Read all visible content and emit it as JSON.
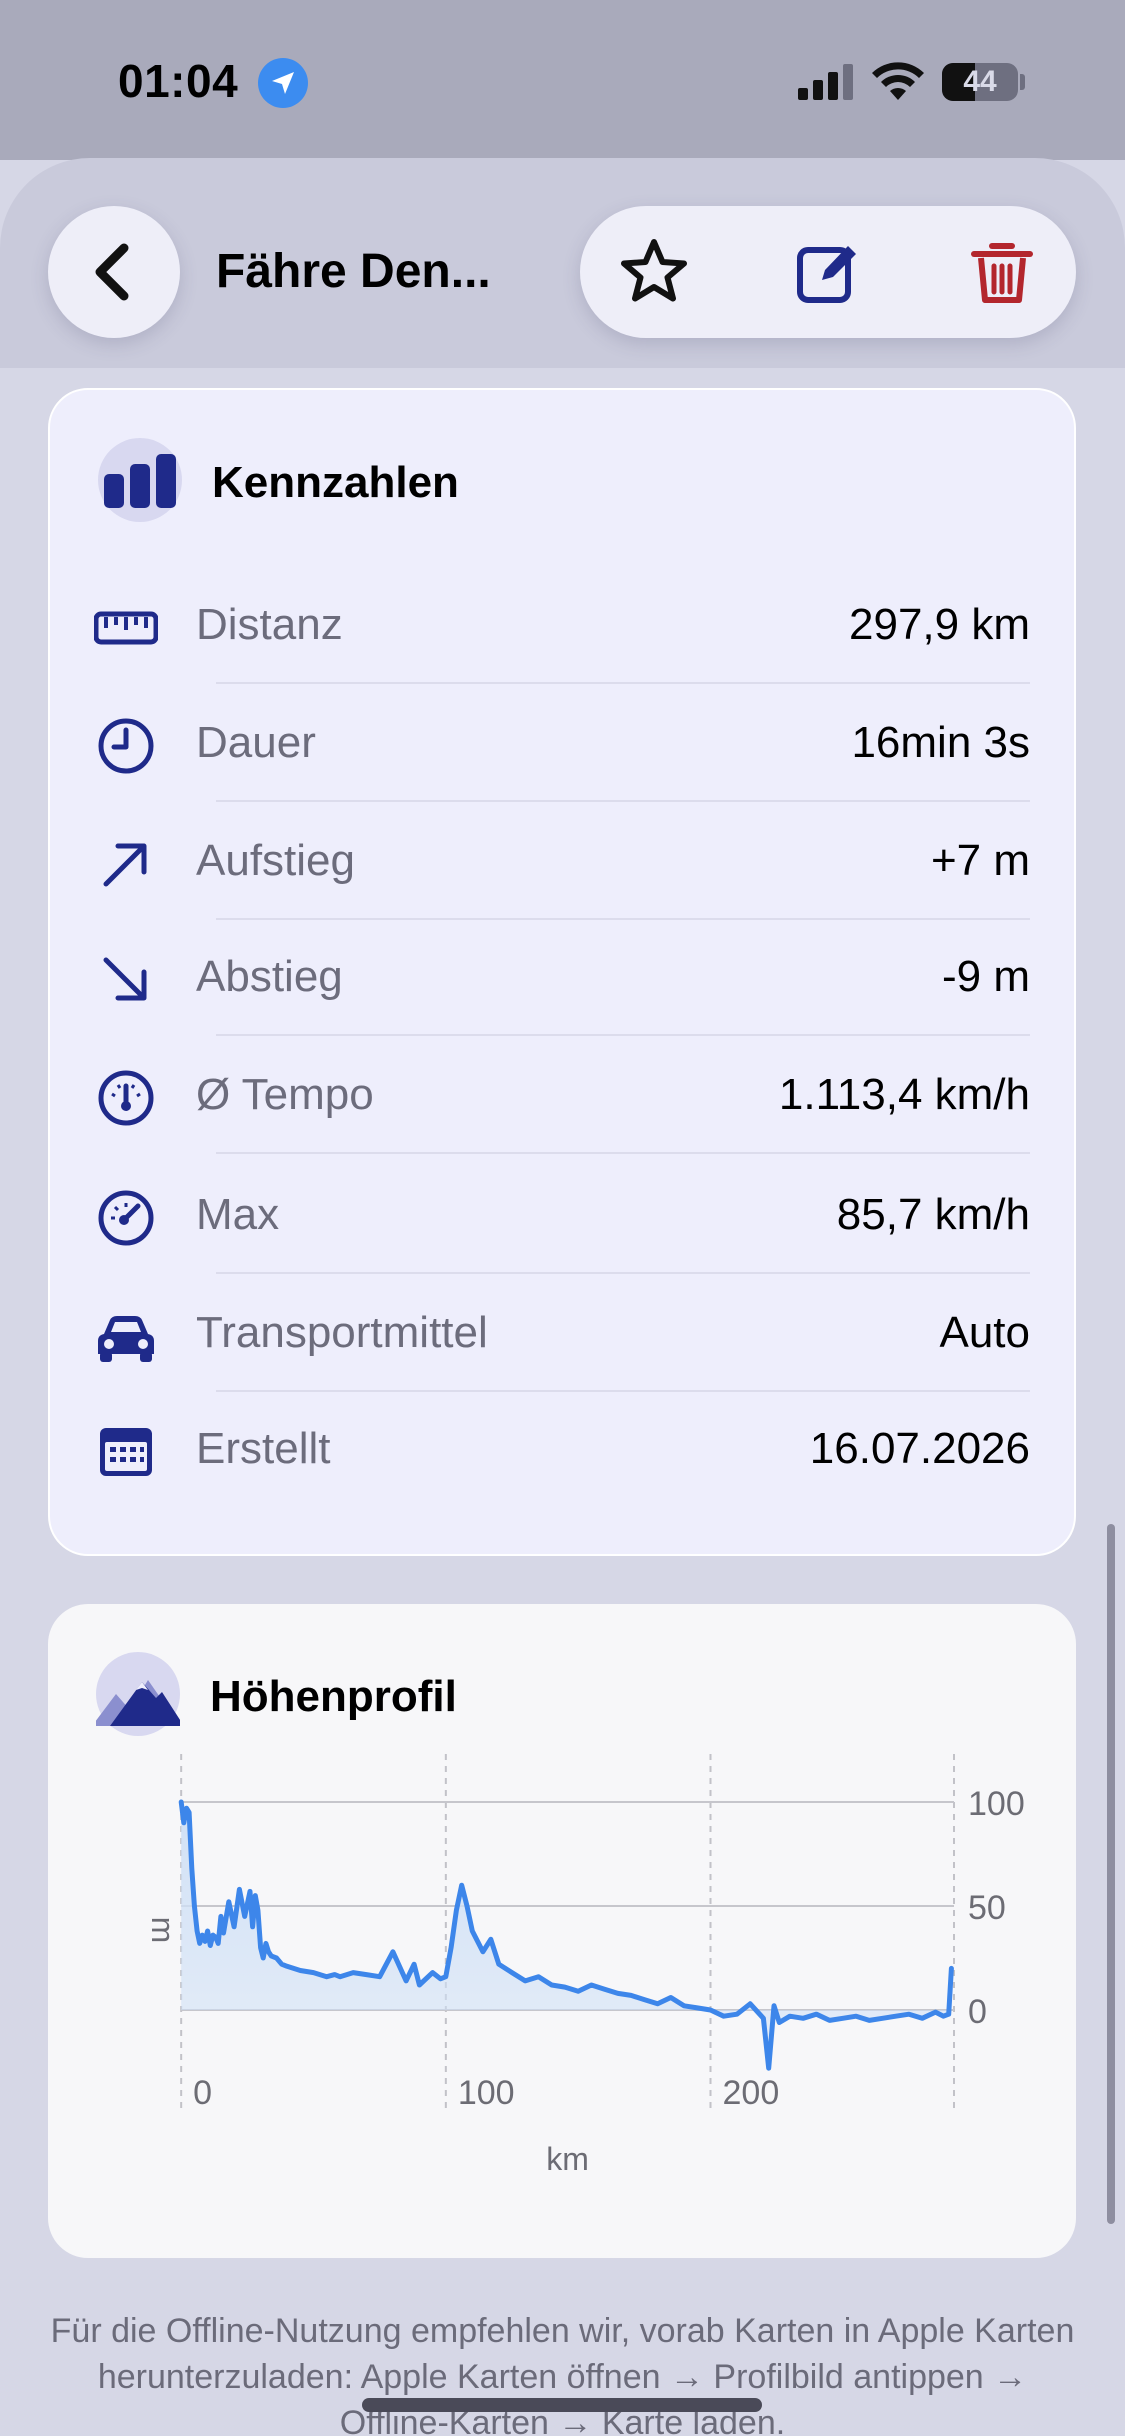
{
  "status_bar": {
    "time": "01:04",
    "battery": "44",
    "battery_level": 0.44
  },
  "nav": {
    "title": "Fähre Den..."
  },
  "colors": {
    "accent": "#1f2a8a",
    "delete": "#b3262d",
    "chart_line": "#3d86ea",
    "chart_fill": "#cfe0f6"
  },
  "stats_card": {
    "title": "Kennzahlen",
    "rows": [
      {
        "icon": "ruler-icon",
        "label": "Distanz",
        "value": "297,9 km"
      },
      {
        "icon": "clock-icon",
        "label": "Dauer",
        "value": "16min 3s"
      },
      {
        "icon": "arrow-up-right-icon",
        "label": "Aufstieg",
        "value": "+7 m"
      },
      {
        "icon": "arrow-down-right-icon",
        "label": "Abstieg",
        "value": "-9 m"
      },
      {
        "icon": "gauge-icon",
        "label": "Ø Tempo",
        "value": "1.113,4 km/h"
      },
      {
        "icon": "speedometer-icon",
        "label": "Max",
        "value": "85,7 km/h"
      },
      {
        "icon": "car-icon",
        "label": "Transportmittel",
        "value": "Auto"
      },
      {
        "icon": "calendar-icon",
        "label": "Erstellt",
        "value": "16.07.2026"
      }
    ]
  },
  "elevation_card": {
    "title": "Höhenprofil"
  },
  "chart_data": {
    "type": "area",
    "xlabel": "km",
    "ylabel": "m",
    "xlim": [
      -8,
      292
    ],
    "ylim": [
      -65,
      100
    ],
    "x_ticks": [
      0,
      100,
      200
    ],
    "y_ticks": [
      0,
      50,
      100
    ],
    "grid": true,
    "series": [
      {
        "x": [
          0,
          1,
          2,
          3,
          4,
          5,
          6,
          7,
          8,
          9,
          10,
          11,
          12,
          13,
          14,
          15,
          16,
          18,
          20,
          22,
          24,
          26,
          27,
          28,
          29,
          30,
          31,
          32,
          33,
          34,
          36,
          38,
          40,
          45,
          50,
          55,
          58,
          60,
          65,
          70,
          75,
          80,
          85,
          88,
          90,
          95,
          98,
          100,
          102,
          104,
          106,
          108,
          110,
          112,
          114,
          117,
          120,
          125,
          130,
          135,
          140,
          145,
          150,
          155,
          160,
          165,
          170,
          175,
          180,
          185,
          190,
          195,
          200,
          205,
          210,
          215,
          220,
          222,
          224,
          226,
          230,
          235,
          240,
          245,
          250,
          255,
          260,
          265,
          270,
          275,
          280,
          285,
          288,
          290,
          291
        ],
        "values": [
          100,
          90,
          97,
          95,
          68,
          50,
          38,
          32,
          36,
          33,
          38,
          31,
          36,
          35,
          32,
          45,
          37,
          52,
          40,
          58,
          45,
          57,
          40,
          55,
          48,
          30,
          25,
          32,
          28,
          26,
          25,
          22,
          21,
          19,
          18,
          16,
          17,
          16,
          18,
          17,
          16,
          28,
          14,
          22,
          12,
          18,
          15,
          16,
          30,
          48,
          60,
          50,
          38,
          33,
          28,
          34,
          22,
          18,
          14,
          16,
          12,
          11,
          9,
          12,
          10,
          8,
          7,
          5,
          3,
          6,
          2,
          1,
          0,
          -3,
          -2,
          3,
          -4,
          -28,
          2,
          -6,
          -3,
          -4,
          -2,
          -5,
          -4,
          -3,
          -5,
          -4,
          -3,
          -2,
          -4,
          -1,
          -3,
          -2,
          20
        ]
      }
    ]
  },
  "footer": {
    "note": "Für die Offline-Nutzung empfehlen wir, vorab Karten in Apple Karten herunterzuladen: Apple Karten öffnen → Profilbild antippen → Offline-Karten → Karte laden."
  }
}
